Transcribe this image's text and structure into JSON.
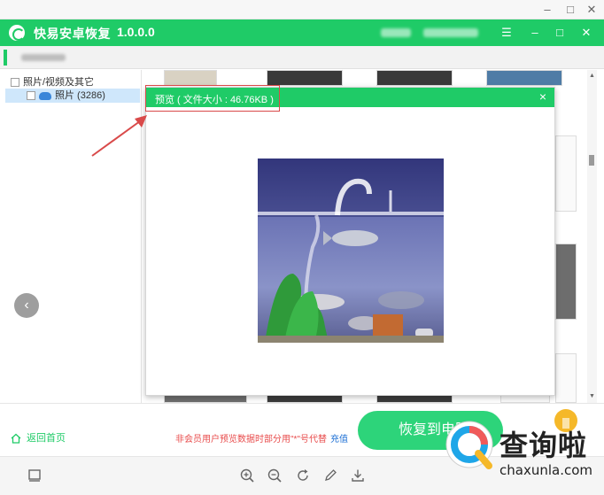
{
  "app": {
    "title": "快易安卓恢复",
    "version": "1.0.0.0"
  },
  "window_controls": [
    "–",
    "□",
    "✕"
  ],
  "header_controls": [
    "☰",
    "–",
    "□",
    "✕"
  ],
  "sidebar": {
    "tree": [
      {
        "label": "照片/视频及其它"
      },
      {
        "label": "照片 (3286)"
      }
    ]
  },
  "preview": {
    "title": "预览 ( 文件大小 : 46.76KB )"
  },
  "bottom": {
    "home_label": "返回首页",
    "notice": "非会员用户预览数据时部分用\"*\"号代替",
    "charge_link": "充值",
    "recover_button": "恢复到电脑"
  },
  "watermark": {
    "text": "查询啦",
    "url": "chaxunla.com"
  },
  "colors": {
    "accent": "#1fcb67",
    "notice_red": "#e84b4b",
    "link_blue": "#1c6fd4",
    "annotation_red": "#d94a4a"
  }
}
